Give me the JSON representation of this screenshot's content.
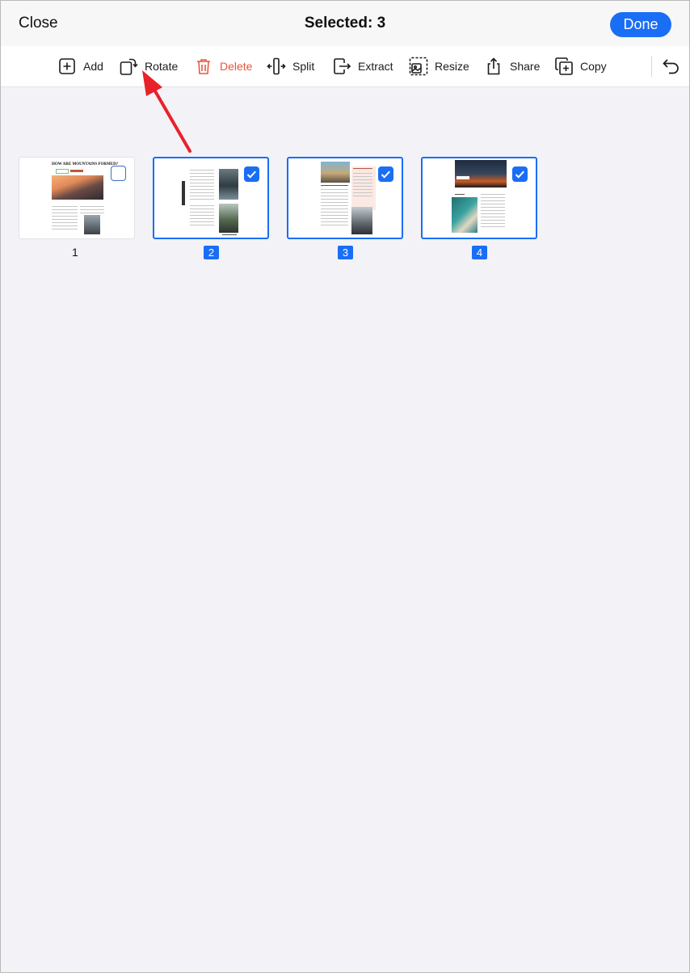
{
  "header": {
    "close_label": "Close",
    "title": "Selected: 3",
    "done_label": "Done"
  },
  "toolbar": {
    "add": "Add",
    "rotate": "Rotate",
    "delete": "Delete",
    "split": "Split",
    "extract": "Extract",
    "resize": "Resize",
    "share": "Share",
    "copy": "Copy"
  },
  "pages": [
    {
      "number": "1",
      "selected": false,
      "title_text": "HOW ARE MOUNTAINS FORMED?"
    },
    {
      "number": "2",
      "selected": true
    },
    {
      "number": "3",
      "selected": true
    },
    {
      "number": "4",
      "selected": true
    }
  ],
  "colors": {
    "accent": "#1a6ef5",
    "danger": "#e8573d",
    "annotation_arrow": "#e8212b"
  }
}
